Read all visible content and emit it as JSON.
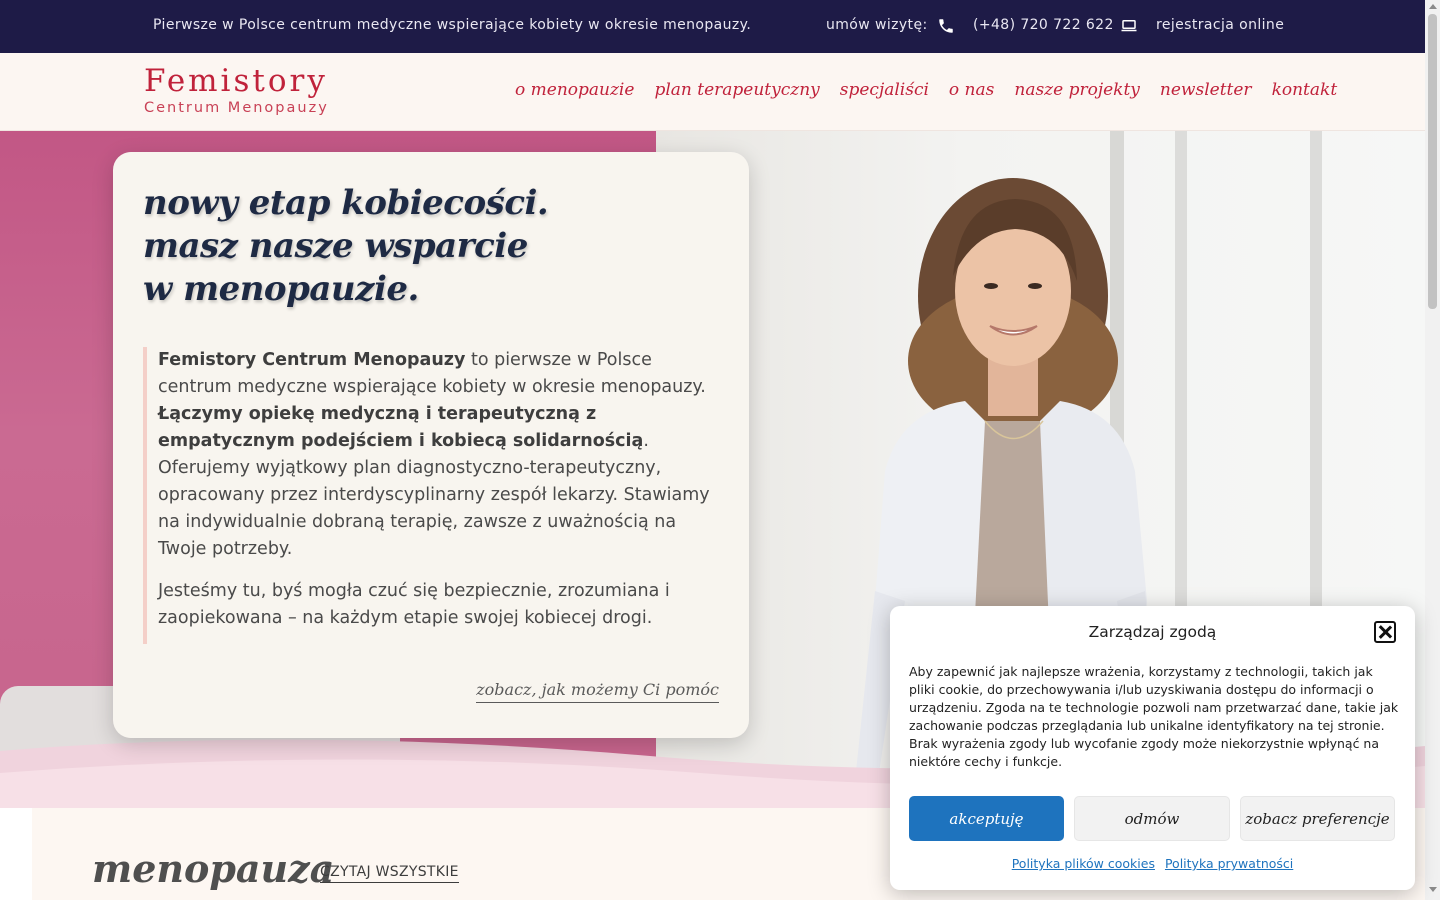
{
  "topbar": {
    "tagline": "Pierwsze w Polsce centrum medyczne wspierające kobiety w okresie menopauzy.",
    "visit_label": "umów wizytę:",
    "phone_icon": "phone-icon",
    "phone": "(+48) 720 722 622",
    "laptop_icon": "laptop-icon",
    "register": "rejestracja online"
  },
  "header": {
    "logo_line1": "Femistory",
    "logo_line2": "Centrum Menopauzy",
    "nav": [
      "o menopauzie",
      "plan terapeutyczny",
      "specjaliści",
      "o nas",
      "nasze projekty",
      "newsletter",
      "kontakt"
    ]
  },
  "hero": {
    "headline_line1": "nowy etap kobiecości.",
    "headline_line2": "masz nasze wsparcie",
    "headline_line3": "w menopauzie.",
    "p1_bold1": "Femistory Centrum Menopauzy",
    "p1_text1": " to pierwsze w Polsce centrum medyczne wspierające kobiety w okresie menopauzy. ",
    "p1_bold2": "Łączymy opiekę medyczną i terapeutyczną z empatycznym podejściem i kobiecą solidarnością",
    "p1_text2": ". Oferujemy wyjątkowy plan diagnostyczno-terapeutyczny, opracowany przez interdyscyplinarny zespół lekarzy. Stawiamy na indywidualnie dobraną terapię, zawsze z uważnością na Twoje potrzeby.",
    "p2": "Jesteśmy tu, byś mogła czuć się bezpiecznie, zrozumiana i zaopiekowana – na każdym etapie swojej kobiecej drogi.",
    "cta": "zobacz, jak możemy Ci pomóc"
  },
  "section": {
    "title": "menopauza",
    "read_all": "CZYTAJ WSZYSTKIE"
  },
  "consent": {
    "title": "Zarządzaj zgodą",
    "text": "Aby zapewnić jak najlepsze wrażenia, korzystamy z technologii, takich jak pliki cookie, do przechowywania i/lub uzyskiwania dostępu do informacji o urządzeniu. Zgoda na te technologie pozwoli nam przetwarzać dane, takie jak zachowanie podczas przeglądania lub unikalne identyfikatory na tej stronie. Brak wyrażenia zgody lub wycofanie zgody może niekorzystnie wpłynąć na niektóre cechy i funkcje.",
    "accept": "akceptuję",
    "deny": "odmów",
    "preferences": "zobacz preferencje",
    "cookie_policy": "Polityka plików cookies",
    "privacy_policy": "Polityka prywatności"
  },
  "colors": {
    "topbar_bg": "#1e1b47",
    "brand_red": "#c0223b",
    "accept_blue": "#1e73be",
    "hero_pink": "#c25785",
    "card_bg": "#f8f5ef"
  }
}
